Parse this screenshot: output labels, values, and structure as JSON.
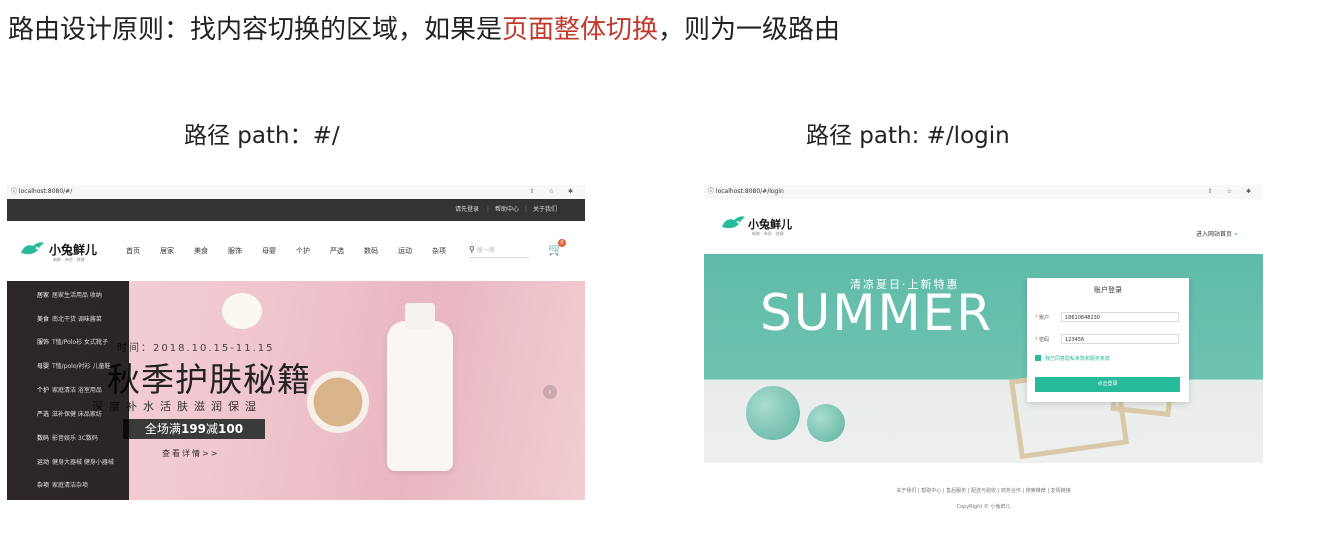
{
  "heading": {
    "prefix": "路由设计原则：找内容切换的区域，如果是",
    "highlight": "页面整体切换",
    "suffix": "，则为一级路由",
    "highlight_color": "#c0392b"
  },
  "left": {
    "caption": "路径 path：#/",
    "url": "localhost:8080/#/",
    "browser_icons": "⇧ ☆ ✱",
    "topnav": [
      "请先登录",
      "帮助中心",
      "关于我们"
    ],
    "logo": {
      "title": "小兔鲜儿",
      "sub": "新鲜 · 亲民 · 快捷"
    },
    "nav": [
      "首页",
      "居家",
      "美食",
      "服饰",
      "母婴",
      "个护",
      "严选",
      "数码",
      "运动",
      "杂项"
    ],
    "search_placeholder": "搜一搜",
    "cart_icon": "cart-icon",
    "cart_count": "0",
    "categories": [
      {
        "name": "居家",
        "sub": "居家生活用品 收纳"
      },
      {
        "name": "美食",
        "sub": "南北干货 调味酱菜"
      },
      {
        "name": "服饰",
        "sub": "T恤/Polo衫 女式靴子"
      },
      {
        "name": "母婴",
        "sub": "T恤/polo/衬衫 儿童鞋"
      },
      {
        "name": "个护",
        "sub": "家庭清洁 浴室用品"
      },
      {
        "name": "严选",
        "sub": "滋补保健 床品家纺"
      },
      {
        "name": "数码",
        "sub": "影音娱乐 3C数码"
      },
      {
        "name": "运动",
        "sub": "健身大器械 健身小器械"
      },
      {
        "name": "杂项",
        "sub": "家庭清洁杂项"
      }
    ],
    "promo": {
      "time": "时间：2018.10.15-11.15",
      "title": "秋季护肤秘籍",
      "subtitle": "深度补水活肤滋润保湿",
      "deal_prefix": "全场满",
      "deal_a": "199",
      "deal_mid": "减",
      "deal_b": "100",
      "more": "查看详情>>"
    }
  },
  "right": {
    "caption": "路径 path: #/login",
    "url": "localhost:8080/#/login",
    "browser_icons": "⇧ ☆ ✱",
    "logo": {
      "title": "小兔鲜儿",
      "sub": "新鲜 · 亲民 · 快捷"
    },
    "enter_home": "进入网站首页",
    "enter_arrow": "»",
    "banner": {
      "small": "清凉夏日·上新特惠",
      "big": "SUMMER"
    },
    "login": {
      "title": "账户登录",
      "account_label": "账户",
      "account_value": "18610848230",
      "password_label": "密码",
      "password_value": "123456",
      "agree": "我已同意隐私条款和服务条款",
      "button": "点击登录"
    },
    "footer_links": "关于我们 | 帮助中心 | 售后服务 | 配送与验收 | 商务合作 | 搜索推荐 | 友情链接",
    "copyright": "CopyRight © 小兔鲜儿"
  },
  "colors": {
    "brand": "#27ba9b",
    "dark": "#333333"
  }
}
